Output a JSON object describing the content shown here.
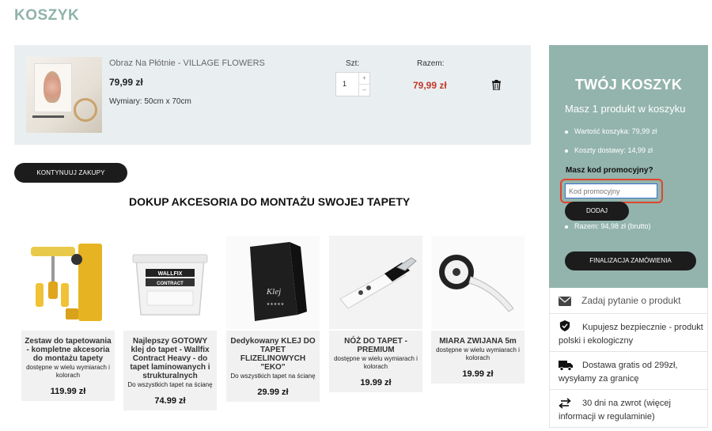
{
  "page": {
    "title": "KOSZYK"
  },
  "cart": {
    "item": {
      "name": "Obraz Na Płótnie - VILLAGE FLOWERS",
      "price": "79,99 zł",
      "dimensions": "Wymiary: 50cm x 70cm",
      "quantity": "1",
      "total": "79,99 zł"
    },
    "labels": {
      "qty": "Szt:",
      "total": "Razem:",
      "plus": "+",
      "minus": "–"
    },
    "continue_button": "KONTYNUUJ ZAKUPY"
  },
  "accessories": {
    "heading": "DOKUP AKCESORIA DO MONTAŻU SWOJEJ TAPETY",
    "products": [
      {
        "name": "Zestaw do tapetowania - kompletne akcesoria do montażu tapety",
        "availability": "dostępne w wielu wymiarach i kolorach",
        "price": "119.99 zł"
      },
      {
        "name": "Najlepszy GOTOWY klej do tapet - Wallfix Contract Heavy - do tapet laminowanych i strukturalnych",
        "availability": "Do wszystkich tapet na ścianę",
        "price": "74.99 zł"
      },
      {
        "name": "Dedykowany KLEJ DO TAPET FLIZELINOWYCH \"EKO\"",
        "availability": "Do wszystkich tapet na ścianę",
        "price": "29.99 zł"
      },
      {
        "name": "NÓŻ DO TAPET - PREMIUM",
        "availability": "dostępne w wielu wymiarach i kolorach",
        "price": "19.99 zł"
      },
      {
        "name": "MIARA ZWIJANA 5m",
        "availability": "dostępne w wielu wymiarach i kolorach",
        "price": "19.99 zł"
      }
    ],
    "product_image_text": {
      "wallfix": "WALLFIX",
      "contract": "CONTRACT",
      "klej": "Klej"
    }
  },
  "summary": {
    "title": "TWÓJ KOSZYK",
    "subtitle": "Masz 1 produkt w koszyku",
    "cart_value": "Wartość koszyka: 79,99 zł",
    "shipping": "Koszty dostawy: 14,99 zł",
    "promo_label": "Masz kod promocyjny?",
    "promo_placeholder": "Kod promocyjny",
    "add_button": "DODAJ",
    "total": "Razem: 94,98 zł (brutto)",
    "finalize_button": "FINALIZACJA ZAMÓWIENIA"
  },
  "info": [
    {
      "icon": "mail-icon",
      "text": "Zadaj pytanie o produkt"
    },
    {
      "icon": "shield-check-icon",
      "text": "Kupujesz bezpiecznie - produkt polski i ekologiczny"
    },
    {
      "icon": "truck-icon",
      "text": "Dostawa gratis od 299zł, wysyłamy za granicę"
    },
    {
      "icon": "return-arrows-icon",
      "text": "30 dni na zwrot (więcej informacji w regulaminie)"
    }
  ],
  "colors": {
    "accent": "#93b4ac",
    "title": "#8fb3aa",
    "price_red": "#c0392b",
    "highlight": "#e0452c"
  }
}
